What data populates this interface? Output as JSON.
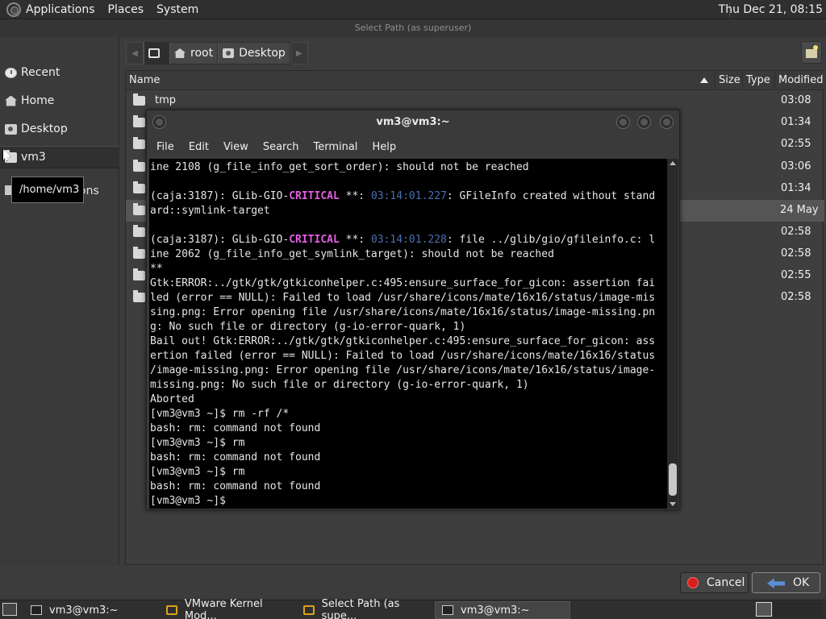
{
  "top_panel": {
    "menus": [
      "Applications",
      "Places",
      "System"
    ],
    "clock": "Thu Dec 21, 08:15"
  },
  "dialog": {
    "title": "Select Path (as superuser)",
    "sidebar": [
      {
        "label": "Recent",
        "icon": "recent-icon"
      },
      {
        "label": "Home",
        "icon": "home-icon"
      },
      {
        "label": "Desktop",
        "icon": "desktop-icon"
      },
      {
        "label": "vm3",
        "icon": "folder-icon"
      }
    ],
    "tooltip": "/home/vm3",
    "obscured_label": "ons",
    "path": [
      "root",
      "Desktop"
    ],
    "columns": {
      "name": "Name",
      "size": "Size",
      "type": "Type",
      "modified": "Modified"
    },
    "files": [
      {
        "name": "tmp",
        "modified": "03:08"
      },
      {
        "name": "",
        "modified": "01:34"
      },
      {
        "name": "",
        "modified": "02:55"
      },
      {
        "name": "",
        "modified": "03:06"
      },
      {
        "name": "",
        "modified": "01:34"
      },
      {
        "name": "",
        "modified": "24 May"
      },
      {
        "name": "",
        "modified": "02:58"
      },
      {
        "name": "",
        "modified": "02:58"
      },
      {
        "name": "",
        "modified": "02:55"
      },
      {
        "name": "",
        "modified": "02:58"
      }
    ],
    "cancel_label": "Cancel",
    "ok_label": "OK"
  },
  "terminal": {
    "title": "vm3@vm3:~",
    "menus": [
      "File",
      "Edit",
      "View",
      "Search",
      "Terminal",
      "Help"
    ],
    "lines": [
      [
        {
          "t": "ine 2108 (g_file_info_get_sort_order): should not be reached"
        }
      ],
      [
        {
          "t": ""
        }
      ],
      [
        {
          "t": "(caja:3187): GLib-GIO-"
        },
        {
          "t": "CRITICAL",
          "c": "crit"
        },
        {
          "t": " **: "
        },
        {
          "t": "03:14:01.227",
          "c": "ts"
        },
        {
          "t": ": GFileInfo created without stand"
        }
      ],
      [
        {
          "t": "ard::symlink-target"
        }
      ],
      [
        {
          "t": ""
        }
      ],
      [
        {
          "t": "(caja:3187): GLib-GIO-"
        },
        {
          "t": "CRITICAL",
          "c": "crit"
        },
        {
          "t": " **: "
        },
        {
          "t": "03:14:01.228",
          "c": "ts"
        },
        {
          "t": ": file ../glib/gio/gfileinfo.c: l"
        }
      ],
      [
        {
          "t": "ine 2062 (g_file_info_get_symlink_target): should not be reached"
        }
      ],
      [
        {
          "t": "**"
        }
      ],
      [
        {
          "t": "Gtk:ERROR:../gtk/gtk/gtkiconhelper.c:495:ensure_surface_for_gicon: assertion fai"
        }
      ],
      [
        {
          "t": "led (error == NULL): Failed to load /usr/share/icons/mate/16x16/status/image-mis"
        }
      ],
      [
        {
          "t": "sing.png: Error opening file /usr/share/icons/mate/16x16/status/image-missing.pn"
        }
      ],
      [
        {
          "t": "g: No such file or directory (g-io-error-quark, 1)"
        }
      ],
      [
        {
          "t": "Bail out! Gtk:ERROR:../gtk/gtk/gtkiconhelper.c:495:ensure_surface_for_gicon: ass"
        }
      ],
      [
        {
          "t": "ertion failed (error == NULL): Failed to load /usr/share/icons/mate/16x16/status"
        }
      ],
      [
        {
          "t": "/image-missing.png: Error opening file /usr/share/icons/mate/16x16/status/image-"
        }
      ],
      [
        {
          "t": "missing.png: No such file or directory (g-io-error-quark, 1)"
        }
      ],
      [
        {
          "t": "Aborted"
        }
      ],
      [
        {
          "t": "[vm3@vm3 ~]$ rm -rf /*"
        }
      ],
      [
        {
          "t": "bash: rm: command not found"
        }
      ],
      [
        {
          "t": "[vm3@vm3 ~]$ rm"
        }
      ],
      [
        {
          "t": "bash: rm: command not found"
        }
      ],
      [
        {
          "t": "[vm3@vm3 ~]$ rm"
        }
      ],
      [
        {
          "t": "bash: rm: command not found"
        }
      ],
      [
        {
          "t": "[vm3@vm3 ~]$"
        }
      ]
    ]
  },
  "taskbar": {
    "items": [
      {
        "label": "vm3@vm3:~",
        "icon": "terminal-icon"
      },
      {
        "label": "VMware Kernel Mod...",
        "icon": "vmware-icon"
      },
      {
        "label": "Select Path (as supe...",
        "icon": "vmware-icon"
      },
      {
        "label": "vm3@vm3:~",
        "icon": "terminal-icon"
      }
    ]
  },
  "colors": {
    "critical": "#e060e0",
    "timestamp": "#4a6fb0",
    "cancel_icon": "#d81e1e",
    "ok_icon": "#5b8ed8"
  }
}
